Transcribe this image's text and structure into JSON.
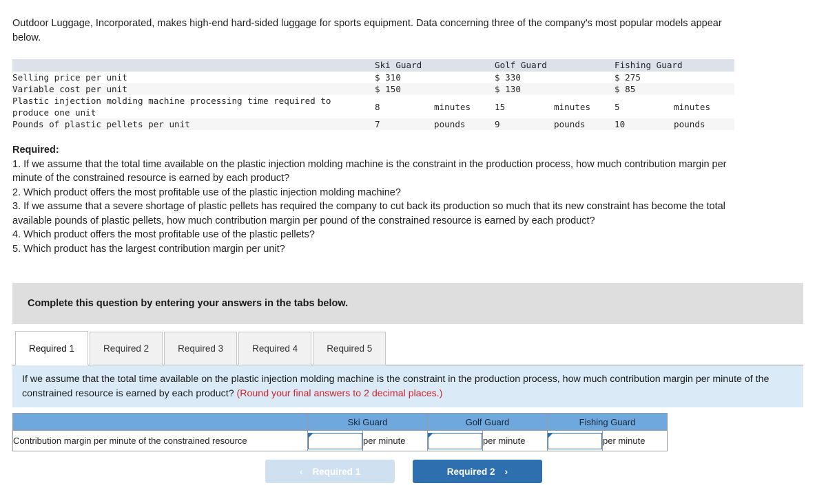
{
  "intro": {
    "paragraph": "Outdoor Luggage, Incorporated, makes high-end hard-sided luggage for sports equipment. Data concerning three of the company's most popular models appear below."
  },
  "data_table": {
    "columns": [
      "Ski Guard",
      "Golf Guard",
      "Fishing Guard"
    ],
    "rows": [
      {
        "label": "Selling price per unit",
        "values": [
          "$ 310",
          "$ 330",
          "$ 275"
        ],
        "units": [
          "",
          "",
          ""
        ]
      },
      {
        "label": "Variable cost per unit",
        "values": [
          "$ 150",
          "$ 130",
          "$ 85"
        ],
        "units": [
          "",
          "",
          ""
        ]
      },
      {
        "label": "Plastic injection molding machine processing time required to\n  produce one unit",
        "values": [
          "8",
          "15",
          "5"
        ],
        "units": [
          "minutes",
          "minutes",
          "minutes"
        ]
      },
      {
        "label": "Pounds of plastic pellets per unit",
        "values": [
          "7",
          "9",
          "10"
        ],
        "units": [
          "pounds",
          "pounds",
          "pounds"
        ]
      }
    ]
  },
  "required": {
    "title": "Required:",
    "items": [
      "1. If we assume that the total time available on the plastic injection molding machine is the constraint in the production process, how much contribution margin per minute of the constrained resource is earned by each product?",
      "2. Which product offers the most profitable use of the plastic injection molding machine?",
      "3. If we assume that a severe shortage of plastic pellets has required the company to cut back its production so much that its new constraint has become the total available pounds of plastic pellets, how much contribution margin per pound of the constrained resource is earned by each product?",
      "4. Which product offers the most profitable use of the plastic pellets?",
      "5. Which product has the largest contribution margin per unit?"
    ]
  },
  "banner": {
    "text": "Complete this question by entering your answers in the tabs below."
  },
  "tabs": {
    "items": [
      {
        "label": "Required 1",
        "active": true
      },
      {
        "label": "Required 2",
        "active": false
      },
      {
        "label": "Required 3",
        "active": false
      },
      {
        "label": "Required 4",
        "active": false
      },
      {
        "label": "Required 5",
        "active": false
      }
    ]
  },
  "question": {
    "text": "If we assume that the total time available on the plastic injection molding machine is the constraint in the production process, how much contribution margin per minute of the constrained resource is earned by each product?",
    "round_note": "(Round your final answers to 2 decimal places.)"
  },
  "answer_table": {
    "blank_header": "",
    "columns": [
      "Ski Guard",
      "Golf Guard",
      "Fishing Guard"
    ],
    "row_label": "Contribution margin per minute of the constrained resource",
    "inputs": [
      {
        "value": "",
        "unit": "per minute"
      },
      {
        "value": "",
        "unit": "per minute"
      },
      {
        "value": "",
        "unit": "per minute"
      }
    ]
  },
  "nav": {
    "prev_label": "Required 1",
    "next_label": "Required 2",
    "prev_chevron": "‹",
    "next_chevron": "›"
  },
  "colors": {
    "accent_blue": "#2e6fb0",
    "header_blue": "#6fa8dc",
    "panel_blue": "#daeaf7",
    "banner_gray": "#dedede",
    "warning_red": "#d0242c"
  }
}
